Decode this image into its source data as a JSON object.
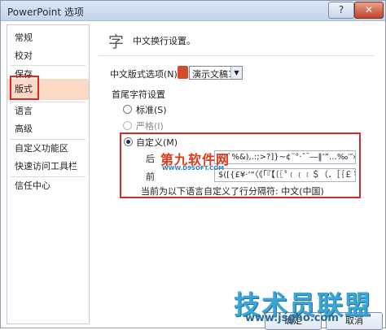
{
  "window": {
    "title": "PowerPoint 选项",
    "help_glyph": "?",
    "close_glyph": "✕"
  },
  "sidebar": {
    "items": [
      {
        "label": "常规"
      },
      {
        "label": "校对"
      },
      {
        "label": "保存"
      },
      {
        "label": "版式",
        "selected": true
      },
      {
        "label": "语言"
      },
      {
        "label": "高级"
      },
      {
        "label": "自定义功能区"
      },
      {
        "label": "快速访问工具栏"
      },
      {
        "label": "信任中心"
      }
    ]
  },
  "main": {
    "header_icon": "字",
    "header_text": "中文换行设置。",
    "option_label": "中文版式选项(N):",
    "document_select": {
      "value": "演示文稿1",
      "arrow": "▼"
    },
    "group_label": "首尾字符设置",
    "radios": [
      {
        "label": "标准(S)",
        "checked": false,
        "enabled": true
      },
      {
        "label": "严格(I)",
        "checked": false,
        "enabled": false
      },
      {
        "label": "自定义(M)",
        "checked": true,
        "enabled": true
      }
    ],
    "fields": [
      {
        "label": "后",
        "value": "!\"'`%&),.:;>?]}~¢¨°·ˇˉ―‖’”…‰′″›℃∶、。〃〉》」』】〕〗〞︶︺︾﹀﹄﹚﹜﹞！＂％＇），．：；？］｝～￠"
      },
      {
        "label": "前",
        "value": "$([{£¥·‘“〈《「『【〔〖〝﹙﹛﹝＄（．［｛￡￥"
      }
    ],
    "note": "当前为以下语言自定义了行分隔符: 中文(中国)"
  },
  "buttons": {
    "ok": "确定",
    "cancel": "取消"
  },
  "watermarks": {
    "top_cn": "第九软件网",
    "top_en": "WWW.D9SOFT.COM",
    "bottom_cn": "技术员联盟",
    "bottom_url": "www.jsgho.com"
  }
}
